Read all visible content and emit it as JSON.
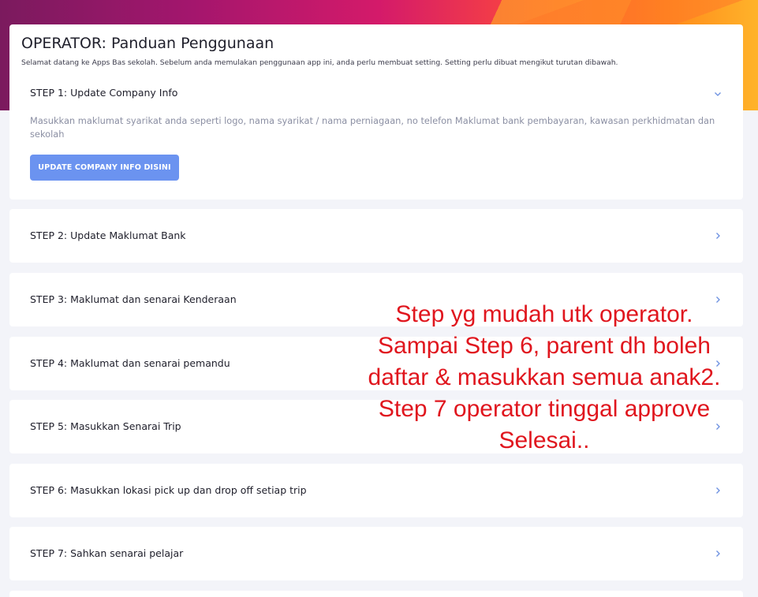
{
  "header": {
    "title": "OPERATOR: Panduan Penggunaan",
    "description": "Selamat datang ke Apps Bas sekolah. Sebelum anda memulakan penggunaan app ini, anda perlu membuat setting. Setting perlu dibuat mengikut turutan dibawah."
  },
  "steps": [
    {
      "title": "STEP 1: Update Company Info",
      "expanded": true,
      "body": "Masukkan maklumat syarikat anda seperti logo, nama syarikat / nama perniagaan, no telefon Maklumat bank pembayaran, kawasan perkhidmatan dan sekolah",
      "button_label": "UPDATE COMPANY INFO DISINI"
    },
    {
      "title": "STEP 2: Update Maklumat Bank",
      "expanded": false
    },
    {
      "title": "STEP 3: Maklumat dan senarai Kenderaan",
      "expanded": false
    },
    {
      "title": "STEP 4: Maklumat dan senarai pemandu",
      "expanded": false
    },
    {
      "title": "STEP 5: Masukkan Senarai Trip",
      "expanded": false
    },
    {
      "title": "STEP 6: Masukkan lokasi pick up dan drop off setiap trip",
      "expanded": false
    },
    {
      "title": "STEP 7: Sahkan senarai pelajar",
      "expanded": false
    }
  ],
  "annotation": {
    "lines": [
      "Step yg mudah utk operator.",
      "Sampai Step 6, parent dh boleh",
      "daftar & masukkan semua anak2.",
      "Step 7 operator tinggal approve",
      "Selesai.."
    ]
  },
  "icons": {
    "expanded": "chevron-down-icon",
    "collapsed": "chevron-right-icon"
  },
  "colors": {
    "accent": "#6b93f0",
    "annotation": "#e0161e",
    "muted_text": "#8b8fa3",
    "page_background": "#f3f4f9"
  }
}
